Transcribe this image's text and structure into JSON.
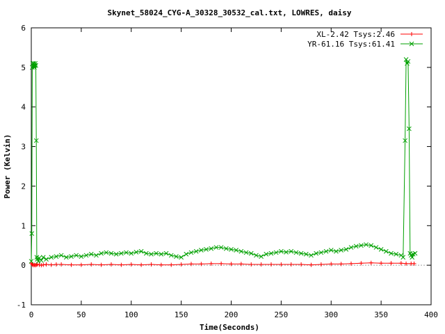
{
  "chart_data": {
    "type": "line",
    "title": "Skynet_58024_CYG-A_30328_30532_cal.txt, LOWRES, daisy",
    "xlabel": "Time(Seconds)",
    "ylabel": "Power (Kelvin)",
    "xlim": [
      0,
      400
    ],
    "ylim": [
      -1,
      6
    ],
    "xticks": [
      0,
      50,
      100,
      150,
      200,
      250,
      300,
      350,
      400
    ],
    "yticks": [
      -1,
      0,
      1,
      2,
      3,
      4,
      5,
      6
    ],
    "grid": false,
    "legend_position": "top-right",
    "series": [
      {
        "name": "XL-2.42 Tsys:2.46",
        "color": "#ff0000",
        "marker": "plus",
        "x": [
          0,
          1,
          2,
          3,
          4,
          5,
          6,
          8,
          10,
          12,
          15,
          20,
          25,
          30,
          40,
          50,
          60,
          70,
          80,
          90,
          100,
          110,
          120,
          130,
          140,
          150,
          160,
          170,
          180,
          190,
          200,
          210,
          220,
          230,
          240,
          250,
          260,
          270,
          280,
          290,
          300,
          310,
          320,
          330,
          340,
          350,
          360,
          370,
          375,
          380,
          383
        ],
        "y": [
          0.05,
          0.02,
          0.0,
          0.01,
          0.0,
          0.01,
          0.02,
          0.01,
          0.0,
          0.01,
          0.02,
          0.01,
          0.02,
          0.02,
          0.01,
          0.01,
          0.02,
          0.01,
          0.02,
          0.01,
          0.02,
          0.01,
          0.02,
          0.01,
          0.01,
          0.02,
          0.03,
          0.03,
          0.04,
          0.04,
          0.03,
          0.03,
          0.02,
          0.02,
          0.02,
          0.02,
          0.02,
          0.02,
          0.01,
          0.02,
          0.03,
          0.03,
          0.04,
          0.05,
          0.06,
          0.05,
          0.05,
          0.05,
          0.04,
          0.04,
          0.04
        ]
      },
      {
        "name": "YR-61.16 Tsys:61.41",
        "color": "#00a000",
        "marker": "x",
        "x": [
          0,
          0.5,
          1,
          1.5,
          2,
          2.5,
          3,
          3.5,
          4,
          4.5,
          5,
          5.5,
          6,
          7,
          8,
          10,
          12,
          15,
          20,
          25,
          30,
          35,
          40,
          45,
          50,
          55,
          60,
          65,
          70,
          75,
          80,
          85,
          90,
          95,
          100,
          105,
          110,
          115,
          120,
          125,
          130,
          135,
          140,
          145,
          150,
          155,
          160,
          165,
          170,
          175,
          180,
          185,
          190,
          195,
          200,
          205,
          210,
          215,
          220,
          225,
          230,
          235,
          240,
          245,
          250,
          255,
          260,
          265,
          270,
          275,
          280,
          285,
          290,
          295,
          300,
          305,
          310,
          315,
          320,
          325,
          330,
          335,
          340,
          345,
          350,
          355,
          360,
          365,
          370,
          372,
          374,
          375,
          376,
          377,
          378,
          379,
          380,
          381,
          382,
          384
        ],
        "y": [
          0.1,
          0.8,
          5.0,
          5.1,
          5.05,
          5.1,
          5.0,
          5.05,
          5.1,
          5.05,
          3.15,
          0.2,
          0.15,
          0.1,
          0.18,
          0.12,
          0.2,
          0.15,
          0.2,
          0.22,
          0.25,
          0.2,
          0.22,
          0.25,
          0.22,
          0.25,
          0.28,
          0.25,
          0.3,
          0.32,
          0.3,
          0.28,
          0.3,
          0.32,
          0.3,
          0.33,
          0.35,
          0.3,
          0.28,
          0.3,
          0.28,
          0.3,
          0.25,
          0.22,
          0.2,
          0.28,
          0.32,
          0.35,
          0.38,
          0.4,
          0.42,
          0.45,
          0.45,
          0.42,
          0.4,
          0.38,
          0.35,
          0.32,
          0.3,
          0.25,
          0.22,
          0.28,
          0.3,
          0.32,
          0.35,
          0.33,
          0.35,
          0.32,
          0.3,
          0.28,
          0.25,
          0.3,
          0.32,
          0.35,
          0.38,
          0.35,
          0.38,
          0.4,
          0.45,
          0.48,
          0.5,
          0.52,
          0.5,
          0.45,
          0.4,
          0.35,
          0.3,
          0.28,
          0.25,
          0.2,
          3.15,
          5.2,
          5.1,
          5.15,
          3.45,
          0.3,
          0.25,
          0.2,
          0.28,
          0.3
        ]
      }
    ]
  }
}
